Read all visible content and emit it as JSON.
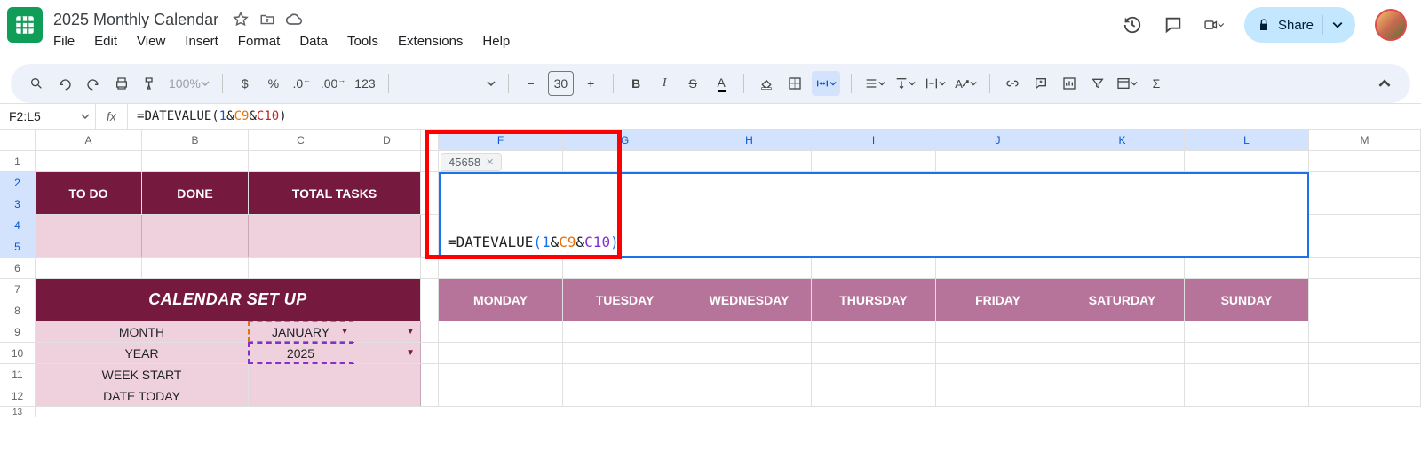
{
  "doc": {
    "title": "2025 Monthly Calendar"
  },
  "menu": {
    "file": "File",
    "edit": "Edit",
    "view": "View",
    "insert": "Insert",
    "format": "Format",
    "data": "Data",
    "tools": "Tools",
    "extensions": "Extensions",
    "help": "Help"
  },
  "share": {
    "label": "Share"
  },
  "toolbar": {
    "zoom": "100%",
    "currency": "$",
    "percent": "%",
    "dec_dec": ".0",
    "dec_inc": ".00",
    "num_fmt": "123",
    "font_size": "30",
    "minus": "−",
    "plus": "+"
  },
  "formula_bar": {
    "name_box": "F2:L5",
    "formula_parts": {
      "eq": "=",
      "fn": "DATEVALUE",
      "open": "(",
      "lit": "1",
      "amp": "&",
      "ref1": "C9",
      "ref2": "C10",
      "close": ")"
    }
  },
  "columns": [
    "A",
    "B",
    "C",
    "D",
    "",
    "F",
    "G",
    "H",
    "I",
    "J",
    "K",
    "L",
    "M"
  ],
  "left_headers": {
    "todo": "TO DO",
    "done": "DONE",
    "total": "TOTAL TASKS"
  },
  "cal_setup": {
    "title": "CALENDAR SET UP",
    "rows": {
      "month_label": "MONTH",
      "month_value": "JANUARY",
      "year_label": "YEAR",
      "year_value": "2025",
      "weekstart_label": "WEEK START",
      "weekstart_value": "",
      "today_label": "DATE TODAY",
      "today_value": ""
    }
  },
  "days": [
    "MONDAY",
    "TUESDAY",
    "WEDNESDAY",
    "THURSDAY",
    "FRIDAY",
    "SATURDAY",
    "SUNDAY"
  ],
  "tooltip": {
    "value": "45658"
  },
  "edit_formula": {
    "eq": "=",
    "fn": "DATEVALUE",
    "open": "(",
    "lit": "1",
    "amp": "&",
    "ref1": "C9",
    "ref2": "C10",
    "close": ")"
  }
}
